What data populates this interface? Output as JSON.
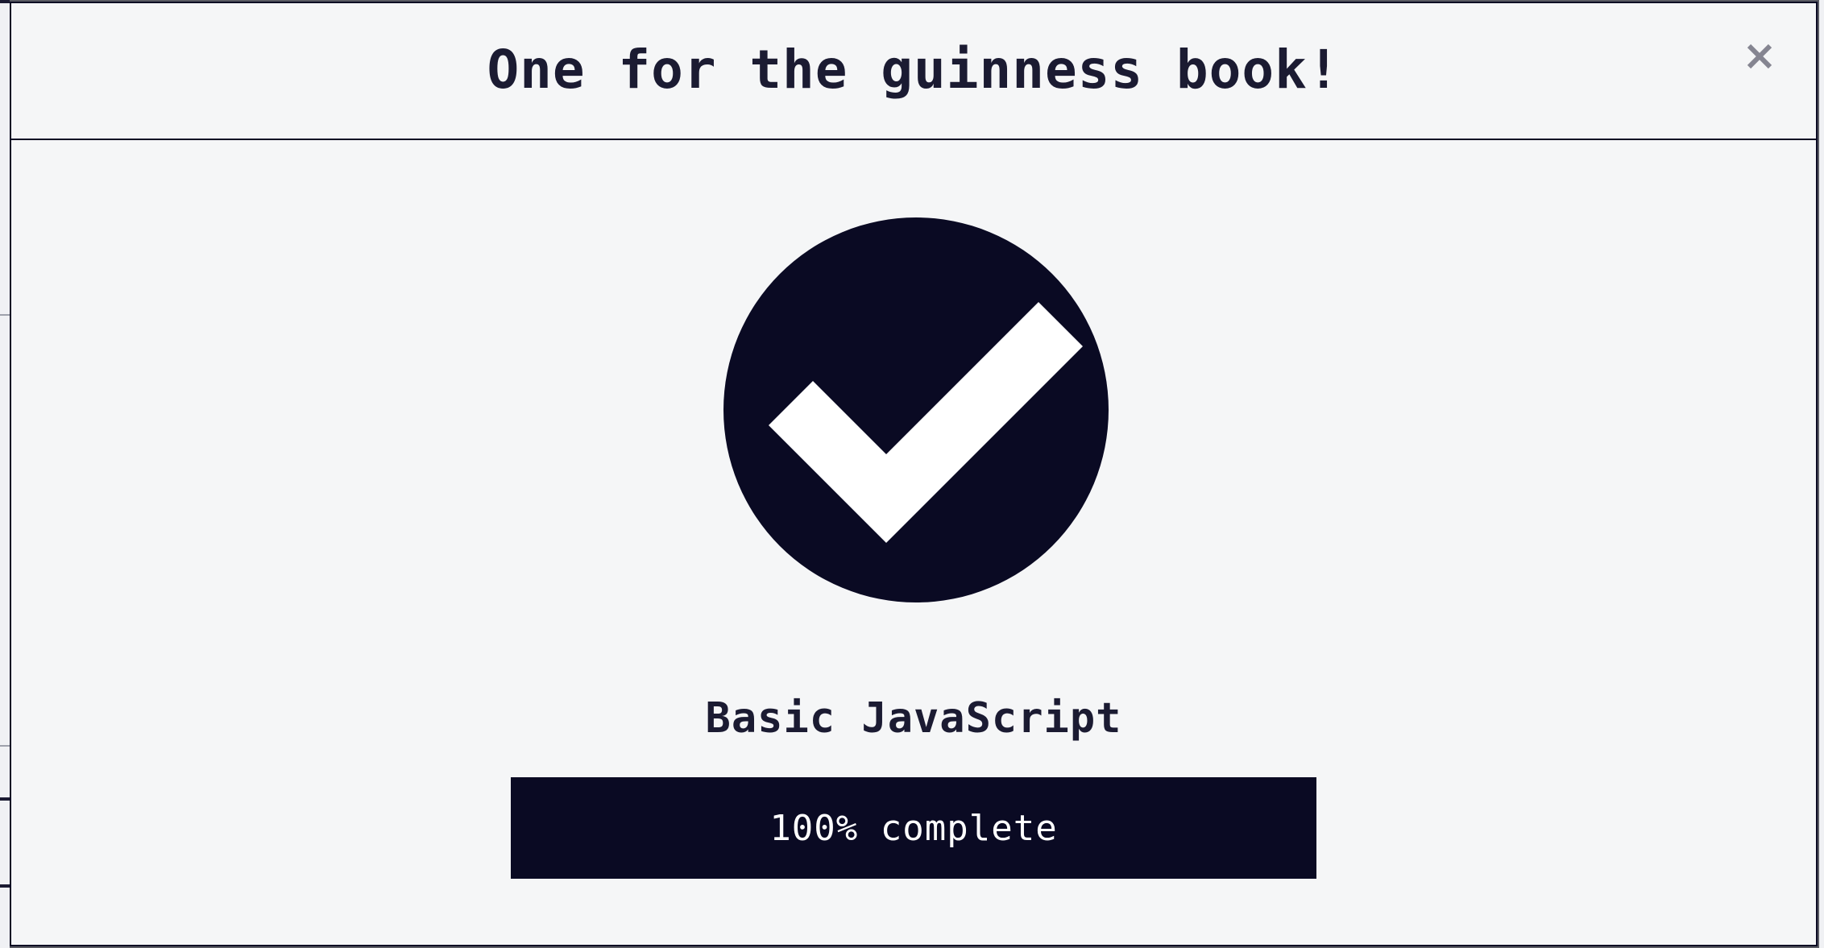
{
  "modal": {
    "title": "One for the guinness book!",
    "close_icon": "close-icon",
    "success_icon": "check-circle-icon",
    "block_title": "Basic JavaScript",
    "progress": {
      "percent": 100,
      "label": "100% complete"
    }
  },
  "colors": {
    "primary": "#0a0a23",
    "background": "#f5f6f7",
    "text": "#1b1b32",
    "close": "#858591"
  }
}
